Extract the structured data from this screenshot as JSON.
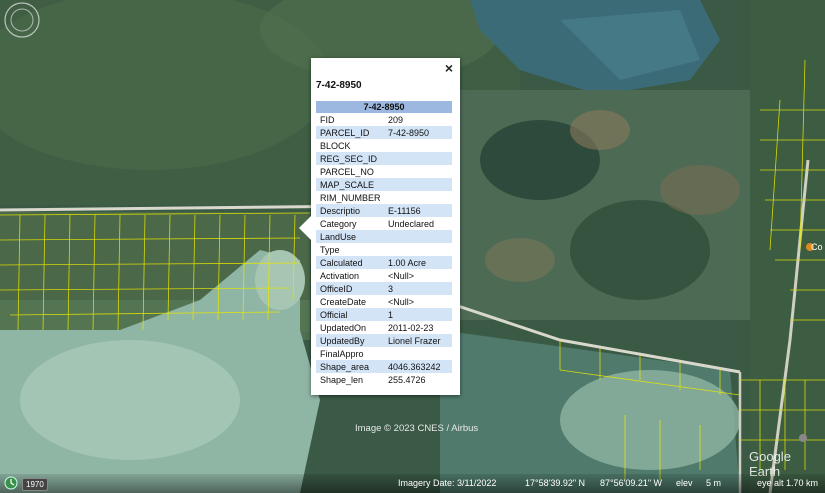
{
  "popup": {
    "title": "7-42-8950",
    "header": "7-42-8950",
    "close_label": "×",
    "rows": [
      {
        "key": "FID",
        "value": "209"
      },
      {
        "key": "PARCEL_ID",
        "value": "7-42-8950"
      },
      {
        "key": "BLOCK",
        "value": ""
      },
      {
        "key": "REG_SEC_ID",
        "value": ""
      },
      {
        "key": "PARCEL_NO",
        "value": ""
      },
      {
        "key": "MAP_SCALE",
        "value": ""
      },
      {
        "key": "RIM_NUMBER",
        "value": ""
      },
      {
        "key": "Descriptio",
        "value": "E-11156"
      },
      {
        "key": "Category",
        "value": "Undeclared"
      },
      {
        "key": "LandUse",
        "value": ""
      },
      {
        "key": "Type",
        "value": ""
      },
      {
        "key": "Calculated",
        "value": "1.00 Acre"
      },
      {
        "key": "Activation",
        "value": "<Null>"
      },
      {
        "key": "OfficeID",
        "value": "3"
      },
      {
        "key": "CreateDate",
        "value": "<Null>"
      },
      {
        "key": "Official",
        "value": "1"
      },
      {
        "key": "UpdatedOn",
        "value": "2011-02-23"
      },
      {
        "key": "UpdatedBy",
        "value": "Lionel Frazer"
      },
      {
        "key": "FinalAppro",
        "value": ""
      },
      {
        "key": "Shape_area",
        "value": "4046.363242"
      },
      {
        "key": "Shape_len",
        "value": "255.4726"
      }
    ]
  },
  "map": {
    "copyright": "Image © 2023 CNES / Airbus",
    "watermark": "Google Earth",
    "poi_label": "Co"
  },
  "status_bar": {
    "year": "1970",
    "imagery_date": "Imagery Date: 3/11/2022",
    "latitude": "17°58'39.92\" N",
    "longitude": "87°56'09.21\" W",
    "elev_label": "elev",
    "elev_value": "5 m",
    "eye_alt": "eye alt  1.70 km"
  },
  "colors": {
    "parcel_lines": "#e6e600",
    "table_header": "#9cb8e0",
    "row_alt": "#d4e4f7"
  }
}
